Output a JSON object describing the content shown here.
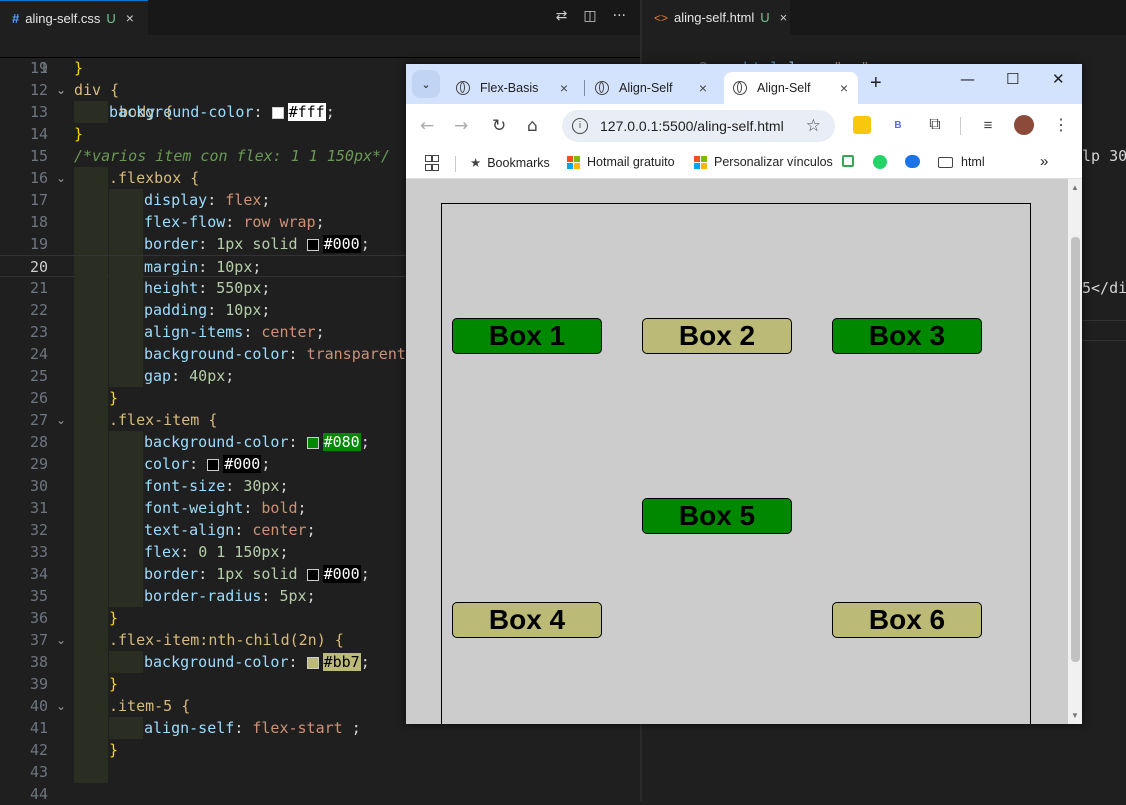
{
  "editor_left": {
    "tab": {
      "icon": "#",
      "filename": "aling-self.css",
      "status": "U",
      "close": "×"
    },
    "toolbar_icons": [
      "compare-icon",
      "split-editor-icon",
      "more-icon"
    ],
    "sticky_line": {
      "num": "9",
      "text": "div, body {"
    },
    "lines": [
      {
        "num": "11",
        "text": "}"
      },
      {
        "num": "12",
        "text": "div {"
      },
      {
        "num": "13",
        "prop": "background-color",
        "swatch": "#ffffff",
        "hex": "#fff"
      },
      {
        "num": "14",
        "text": "}"
      },
      {
        "num": "15",
        "comment": "/*varios item con flex: 1 1 150px*/"
      },
      {
        "num": "16",
        "text": ".flexbox {"
      },
      {
        "num": "17",
        "prop": "display",
        "value": "flex"
      },
      {
        "num": "18",
        "prop": "flex-flow",
        "value": "row wrap"
      },
      {
        "num": "19",
        "prop": "border",
        "value": "1px solid",
        "swatch": "#000000",
        "hex": "#000"
      },
      {
        "num": "20",
        "prop": "margin",
        "value": "10px"
      },
      {
        "num": "21",
        "prop": "height",
        "value": "550px"
      },
      {
        "num": "22",
        "prop": "padding",
        "value": "10px"
      },
      {
        "num": "23",
        "prop": "align-items",
        "value": "center"
      },
      {
        "num": "24",
        "prop": "background-color",
        "value": "transparent"
      },
      {
        "num": "25",
        "prop": "gap",
        "value": "40px"
      },
      {
        "num": "26",
        "text": "}"
      },
      {
        "num": "27",
        "text": ".flex-item {"
      },
      {
        "num": "28",
        "prop": "background-color",
        "swatch": "#008800",
        "hex": "#080"
      },
      {
        "num": "29",
        "prop": "color",
        "swatch": "#000000",
        "hex": "#000"
      },
      {
        "num": "30",
        "prop": "font-size",
        "value": "30px"
      },
      {
        "num": "31",
        "prop": "font-weight",
        "value": "bold"
      },
      {
        "num": "32",
        "prop": "text-align",
        "value": "center"
      },
      {
        "num": "33",
        "prop": "flex",
        "value": "0 1 150px"
      },
      {
        "num": "34",
        "prop": "border",
        "value": "1px solid",
        "swatch": "#000000",
        "hex": "#000"
      },
      {
        "num": "35",
        "prop": "border-radius",
        "value": "5px"
      },
      {
        "num": "36",
        "text": "}"
      },
      {
        "num": "37",
        "text": ".flex-item:nth-child(2n) {"
      },
      {
        "num": "38",
        "prop": "background-color",
        "swatch": "#bbbb77",
        "hex": "#bb7"
      },
      {
        "num": "39",
        "text": "}"
      },
      {
        "num": "40",
        "text": ".item-5 {"
      },
      {
        "num": "41",
        "prop": "align-self",
        "value": "flex-start "
      },
      {
        "num": "42",
        "text": "}"
      },
      {
        "num": "43",
        "text": ""
      },
      {
        "num": "44",
        "text": ""
      }
    ]
  },
  "editor_right": {
    "tab": {
      "icon": "<>",
      "filename": "aling-self.html",
      "status": "U",
      "close": "×"
    },
    "line2": {
      "num": "2",
      "tag_open": "<html",
      "attr": "lang",
      "eq": "=",
      "value": "\"en\"",
      "tag_close": ">"
    },
    "fragments": [
      "lp 30",
      "5</di"
    ]
  },
  "browser": {
    "tabs": [
      {
        "title": "Flex-Basis",
        "close": "×"
      },
      {
        "title": "Align-Self",
        "close": "×"
      },
      {
        "title": "Align-Self",
        "close": "×",
        "active": true
      }
    ],
    "new_tab": "+",
    "window_controls": [
      "—",
      "☐",
      "✕"
    ],
    "url": "127.0.0.1:5500/aling-self.html",
    "bookmarks": [
      {
        "label": "Bookmarks",
        "icon": "star-icon"
      },
      {
        "label": "Hotmail gratuito",
        "icon": "microsoft-logo-icon"
      },
      {
        "label": "Personalizar vínculos",
        "icon": "microsoft-logo-icon"
      },
      {
        "label": "html",
        "icon": "folder-icon"
      }
    ],
    "more_bookmarks": "»",
    "boxes": [
      {
        "label": "Box 1",
        "color": "#008800"
      },
      {
        "label": "Box 2",
        "color": "#bbbb77"
      },
      {
        "label": "Box 3",
        "color": "#008800"
      },
      {
        "label": "Box 4",
        "color": "#bbbb77"
      },
      {
        "label": "Box 5",
        "color": "#008800"
      },
      {
        "label": "Box 6",
        "color": "#bbbb77"
      }
    ]
  }
}
